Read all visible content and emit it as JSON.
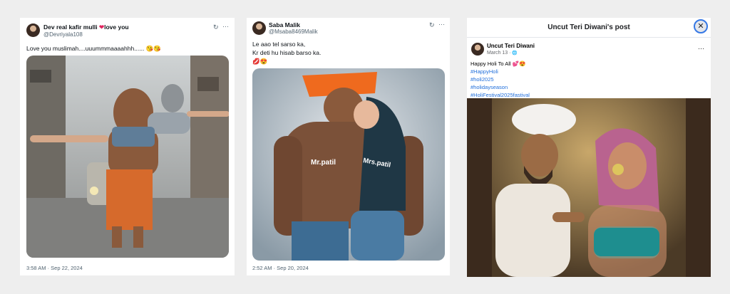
{
  "post1": {
    "author_name": "Dev real kafir mulli",
    "author_name_suffix": "love you",
    "heart_glyph": "❤",
    "handle": "@Devriyala108",
    "text": "Love you muslimah....uuummmaaaahhh......",
    "text_emoji": "😘😘",
    "timestamp": "3:58 AM · Sep 22, 2024",
    "image_caption": ""
  },
  "post2": {
    "author_name": "Saba Malik",
    "handle": "@Msaba8469Malik",
    "lines": [
      "Le aao tel sarso ka,",
      "Kr deti hu hisab barso ka.",
      "💋😍"
    ],
    "image_label_left": "Mr.patil",
    "image_label_right": "Mrs.patil",
    "timestamp": "2:52 AM · Sep 20, 2024"
  },
  "post3": {
    "header_title": "Uncut Teri Diwani's post",
    "close_glyph": "✕",
    "author_name": "Uncut Teri Diwani",
    "date": "March 13 · ",
    "text": "Happy Holi To All 💕😍",
    "hashtags": [
      "#HappyHoli",
      "#holi2025",
      "#holidayseason",
      "#HoliFestival2025fastival"
    ],
    "more_glyph": "···"
  },
  "icons": {
    "refresh": "↻",
    "more": "···",
    "globe": "🌐"
  }
}
